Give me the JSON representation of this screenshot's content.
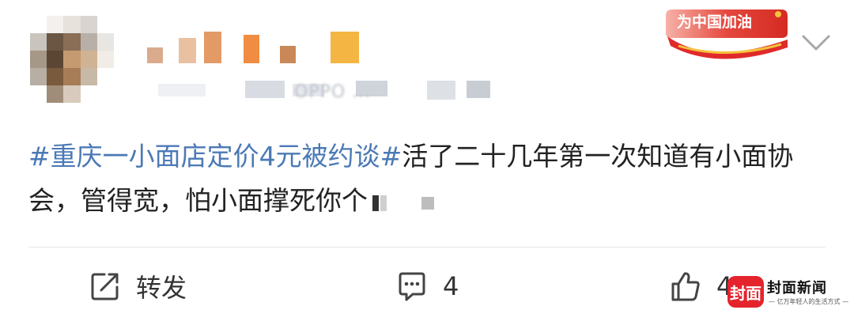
{
  "post": {
    "meta_partial": "OPPO ...",
    "badge": "为中国加油",
    "content": {
      "hashtag": "#重庆一小面店定价4元被约谈#",
      "text": "活了二十几年第一次知道有小面协会，管得宽，怕小面撑死你个"
    },
    "actions": {
      "repost_label": "转发",
      "comment_count": "4",
      "like_count": "47"
    }
  },
  "watermark": {
    "logo": "封面",
    "name": "封面新闻",
    "slogan": "— 亿万年轻人的生活方式 —"
  },
  "colors": {
    "hashtag": "#4b79b5",
    "badge_red": "#e02a2a",
    "badge_gold": "#f4c33a",
    "watermark_red": "#e4232c"
  },
  "icons": [
    "repost-icon",
    "comment-icon",
    "like-icon",
    "chevron-down-icon"
  ]
}
